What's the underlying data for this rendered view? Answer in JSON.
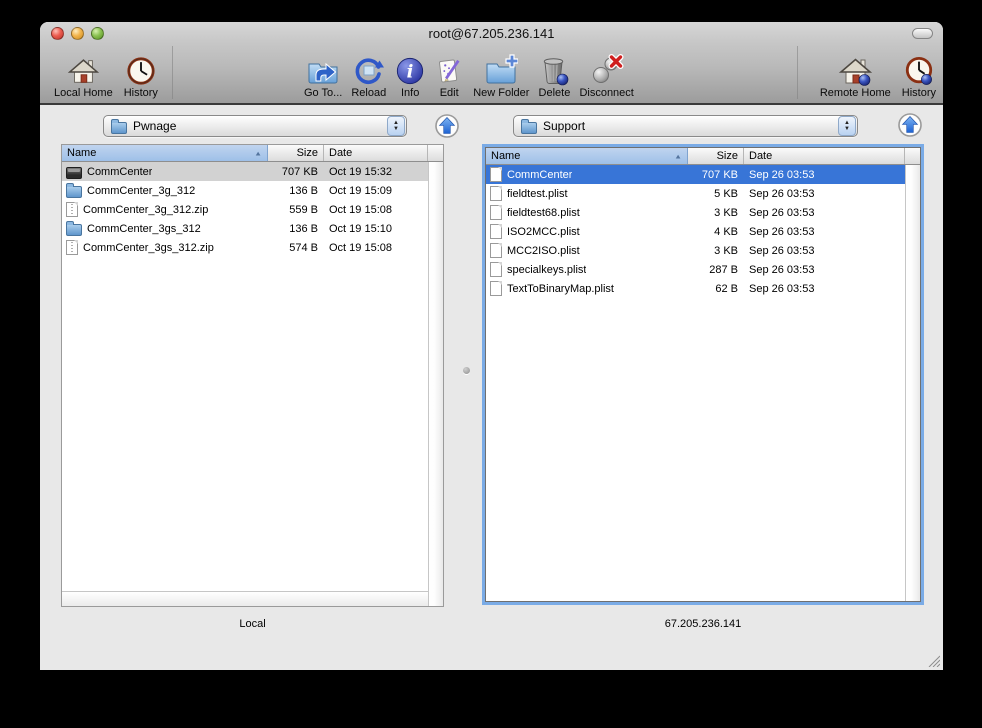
{
  "window": {
    "title": "root@67.205.236.141"
  },
  "toolbar": {
    "local_home": "Local Home",
    "history_local": "History",
    "go_to": "Go To...",
    "reload": "Reload",
    "info": "Info",
    "edit": "Edit",
    "new_folder": "New Folder",
    "delete": "Delete",
    "disconnect": "Disconnect",
    "remote_home": "Remote Home",
    "history_remote": "History"
  },
  "left_pane": {
    "path_selector": "Pwnage",
    "columns": [
      "Name",
      "Size",
      "Date"
    ],
    "sort_column": "Name",
    "sort_indicator": "▲",
    "rows": [
      {
        "name": "CommCenter",
        "size": "707 KB",
        "date": "Oct 19 15:32",
        "icon": "executable",
        "selected": true
      },
      {
        "name": "CommCenter_3g_312",
        "size": "136 B",
        "date": "Oct 19 15:09",
        "icon": "folder"
      },
      {
        "name": "CommCenter_3g_312.zip",
        "size": "559 B",
        "date": "Oct 19 15:08",
        "icon": "zip"
      },
      {
        "name": "CommCenter_3gs_312",
        "size": "136 B",
        "date": "Oct 19 15:10",
        "icon": "folder"
      },
      {
        "name": "CommCenter_3gs_312.zip",
        "size": "574 B",
        "date": "Oct 19 15:08",
        "icon": "zip"
      }
    ],
    "footer_label": "Local"
  },
  "right_pane": {
    "path_selector": "Support",
    "columns": [
      "Name",
      "Size",
      "Date"
    ],
    "sort_column": "Name",
    "sort_indicator": "▲",
    "rows": [
      {
        "name": "CommCenter",
        "size": "707 KB",
        "date": "Sep 26 03:53",
        "icon": "doc",
        "selected": true
      },
      {
        "name": "fieldtest.plist",
        "size": "5 KB",
        "date": "Sep 26 03:53",
        "icon": "doc"
      },
      {
        "name": "fieldtest68.plist",
        "size": "3 KB",
        "date": "Sep 26 03:53",
        "icon": "doc"
      },
      {
        "name": "ISO2MCC.plist",
        "size": "4 KB",
        "date": "Sep 26 03:53",
        "icon": "doc"
      },
      {
        "name": "MCC2ISO.plist",
        "size": "3 KB",
        "date": "Sep 26 03:53",
        "icon": "doc"
      },
      {
        "name": "specialkeys.plist",
        "size": "287 B",
        "date": "Sep 26 03:53",
        "icon": "doc"
      },
      {
        "name": "TextToBinaryMap.plist",
        "size": "62 B",
        "date": "Sep 26 03:53",
        "icon": "doc"
      }
    ],
    "footer_label": "67.205.236.141"
  },
  "colors": {
    "selection_active": "#3875d7",
    "selection_inactive": "#d2d2d2",
    "focus_ring": "#7aabe6",
    "header_sorted": "#9ec0e8",
    "window_chrome": "#b9b9b9",
    "content_bg": "#e8e8e8"
  }
}
